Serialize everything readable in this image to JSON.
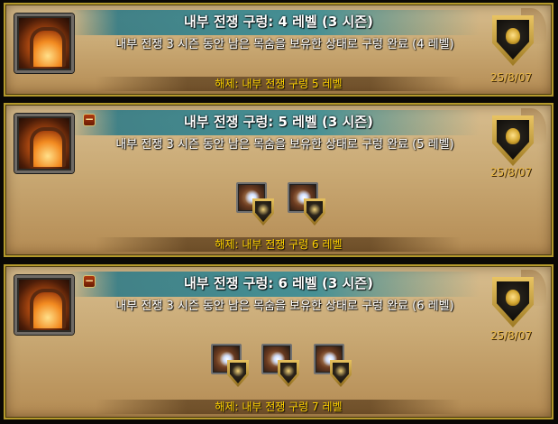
{
  "achievements": [
    {
      "title": "내부 전쟁 구렁: 4 레벨 (3 시즌)",
      "description": "내부 전쟁 3 시즌 동안 남은 목숨을 보유한 상태로 구렁 완료 (4 레벨)",
      "date": "25/8/07",
      "footer": "해제: 내부 전쟁 구렁 5 레벨",
      "has_collapse_button": false,
      "collapse_symbol": "",
      "reward_count": 0,
      "icon": "dungeon-archway-icon",
      "badge_icon": "lion-shield-icon"
    },
    {
      "title": "내부 전쟁 구렁: 5 레벨 (3 시즌)",
      "description": "내부 전쟁 3 시즌 동안 남은 목숨을 보유한 상태로 구렁 완료 (5 레벨)",
      "date": "25/8/07",
      "footer": "해제: 내부 전쟁 구렁 6 레벨",
      "has_collapse_button": true,
      "collapse_symbol": "−",
      "reward_count": 2,
      "icon": "dungeon-archway-icon",
      "badge_icon": "lion-shield-icon"
    },
    {
      "title": "내부 전쟁 구렁: 6 레벨 (3 시즌)",
      "description": "내부 전쟁 3 시즌 동안 남은 목숨을 보유한 상태로 구렁 완료 (6 레벨)",
      "date": "25/8/07",
      "footer": "해제: 내부 전쟁 구렁 7 레벨",
      "has_collapse_button": true,
      "collapse_symbol": "−",
      "reward_count": 3,
      "icon": "dungeon-archway-icon",
      "badge_icon": "lion-shield-icon"
    }
  ],
  "colors": {
    "title_text": "#ffffff",
    "footer_text": "#ffd200",
    "date_text": "#e7b645",
    "card_border": "#b59a2c"
  }
}
